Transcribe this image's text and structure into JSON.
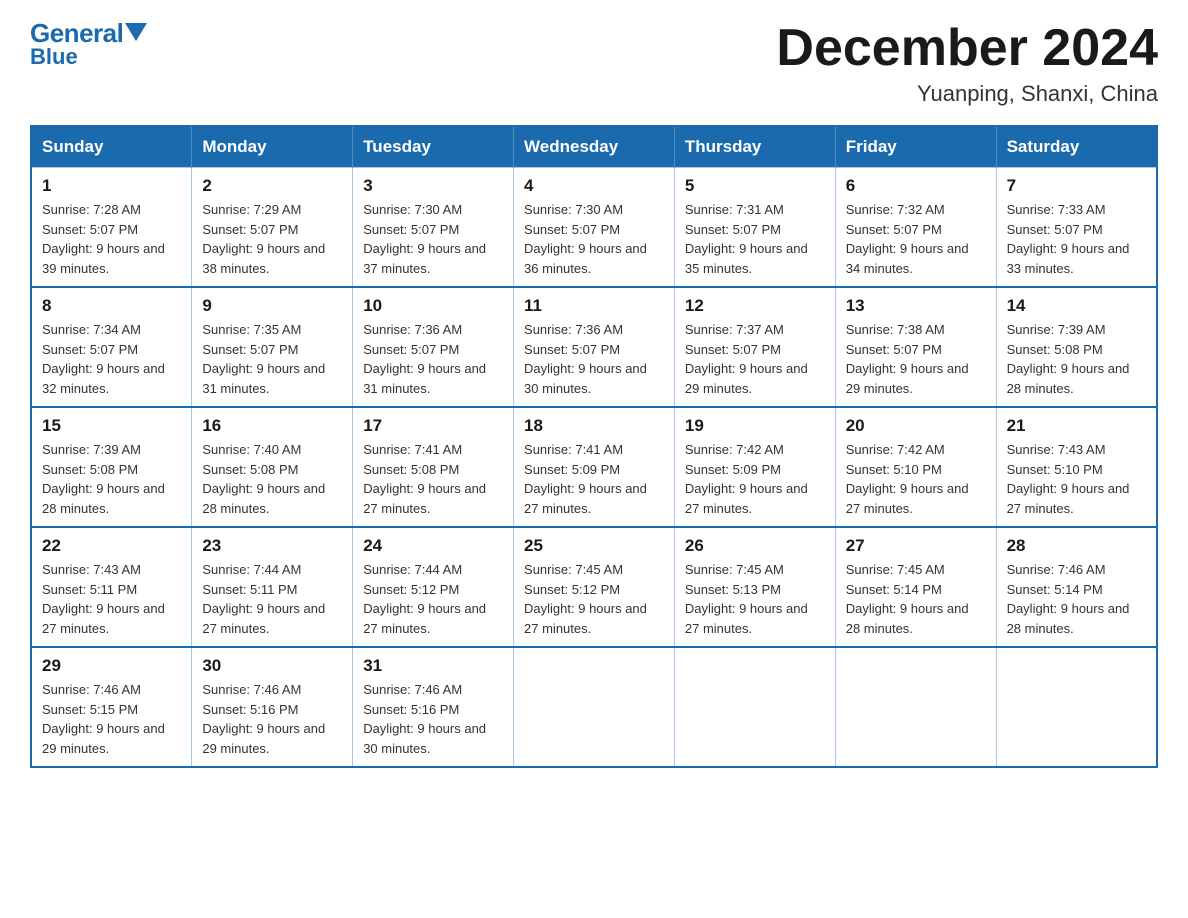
{
  "header": {
    "logo": {
      "general": "General",
      "blue": "Blue"
    },
    "title": "December 2024",
    "location": "Yuanping, Shanxi, China"
  },
  "calendar": {
    "headers": [
      "Sunday",
      "Monday",
      "Tuesday",
      "Wednesday",
      "Thursday",
      "Friday",
      "Saturday"
    ],
    "weeks": [
      [
        {
          "day": "1",
          "sunrise": "7:28 AM",
          "sunset": "5:07 PM",
          "daylight": "9 hours and 39 minutes."
        },
        {
          "day": "2",
          "sunrise": "7:29 AM",
          "sunset": "5:07 PM",
          "daylight": "9 hours and 38 minutes."
        },
        {
          "day": "3",
          "sunrise": "7:30 AM",
          "sunset": "5:07 PM",
          "daylight": "9 hours and 37 minutes."
        },
        {
          "day": "4",
          "sunrise": "7:30 AM",
          "sunset": "5:07 PM",
          "daylight": "9 hours and 36 minutes."
        },
        {
          "day": "5",
          "sunrise": "7:31 AM",
          "sunset": "5:07 PM",
          "daylight": "9 hours and 35 minutes."
        },
        {
          "day": "6",
          "sunrise": "7:32 AM",
          "sunset": "5:07 PM",
          "daylight": "9 hours and 34 minutes."
        },
        {
          "day": "7",
          "sunrise": "7:33 AM",
          "sunset": "5:07 PM",
          "daylight": "9 hours and 33 minutes."
        }
      ],
      [
        {
          "day": "8",
          "sunrise": "7:34 AM",
          "sunset": "5:07 PM",
          "daylight": "9 hours and 32 minutes."
        },
        {
          "day": "9",
          "sunrise": "7:35 AM",
          "sunset": "5:07 PM",
          "daylight": "9 hours and 31 minutes."
        },
        {
          "day": "10",
          "sunrise": "7:36 AM",
          "sunset": "5:07 PM",
          "daylight": "9 hours and 31 minutes."
        },
        {
          "day": "11",
          "sunrise": "7:36 AM",
          "sunset": "5:07 PM",
          "daylight": "9 hours and 30 minutes."
        },
        {
          "day": "12",
          "sunrise": "7:37 AM",
          "sunset": "5:07 PM",
          "daylight": "9 hours and 29 minutes."
        },
        {
          "day": "13",
          "sunrise": "7:38 AM",
          "sunset": "5:07 PM",
          "daylight": "9 hours and 29 minutes."
        },
        {
          "day": "14",
          "sunrise": "7:39 AM",
          "sunset": "5:08 PM",
          "daylight": "9 hours and 28 minutes."
        }
      ],
      [
        {
          "day": "15",
          "sunrise": "7:39 AM",
          "sunset": "5:08 PM",
          "daylight": "9 hours and 28 minutes."
        },
        {
          "day": "16",
          "sunrise": "7:40 AM",
          "sunset": "5:08 PM",
          "daylight": "9 hours and 28 minutes."
        },
        {
          "day": "17",
          "sunrise": "7:41 AM",
          "sunset": "5:08 PM",
          "daylight": "9 hours and 27 minutes."
        },
        {
          "day": "18",
          "sunrise": "7:41 AM",
          "sunset": "5:09 PM",
          "daylight": "9 hours and 27 minutes."
        },
        {
          "day": "19",
          "sunrise": "7:42 AM",
          "sunset": "5:09 PM",
          "daylight": "9 hours and 27 minutes."
        },
        {
          "day": "20",
          "sunrise": "7:42 AM",
          "sunset": "5:10 PM",
          "daylight": "9 hours and 27 minutes."
        },
        {
          "day": "21",
          "sunrise": "7:43 AM",
          "sunset": "5:10 PM",
          "daylight": "9 hours and 27 minutes."
        }
      ],
      [
        {
          "day": "22",
          "sunrise": "7:43 AM",
          "sunset": "5:11 PM",
          "daylight": "9 hours and 27 minutes."
        },
        {
          "day": "23",
          "sunrise": "7:44 AM",
          "sunset": "5:11 PM",
          "daylight": "9 hours and 27 minutes."
        },
        {
          "day": "24",
          "sunrise": "7:44 AM",
          "sunset": "5:12 PM",
          "daylight": "9 hours and 27 minutes."
        },
        {
          "day": "25",
          "sunrise": "7:45 AM",
          "sunset": "5:12 PM",
          "daylight": "9 hours and 27 minutes."
        },
        {
          "day": "26",
          "sunrise": "7:45 AM",
          "sunset": "5:13 PM",
          "daylight": "9 hours and 27 minutes."
        },
        {
          "day": "27",
          "sunrise": "7:45 AM",
          "sunset": "5:14 PM",
          "daylight": "9 hours and 28 minutes."
        },
        {
          "day": "28",
          "sunrise": "7:46 AM",
          "sunset": "5:14 PM",
          "daylight": "9 hours and 28 minutes."
        }
      ],
      [
        {
          "day": "29",
          "sunrise": "7:46 AM",
          "sunset": "5:15 PM",
          "daylight": "9 hours and 29 minutes."
        },
        {
          "day": "30",
          "sunrise": "7:46 AM",
          "sunset": "5:16 PM",
          "daylight": "9 hours and 29 minutes."
        },
        {
          "day": "31",
          "sunrise": "7:46 AM",
          "sunset": "5:16 PM",
          "daylight": "9 hours and 30 minutes."
        },
        null,
        null,
        null,
        null
      ]
    ]
  }
}
